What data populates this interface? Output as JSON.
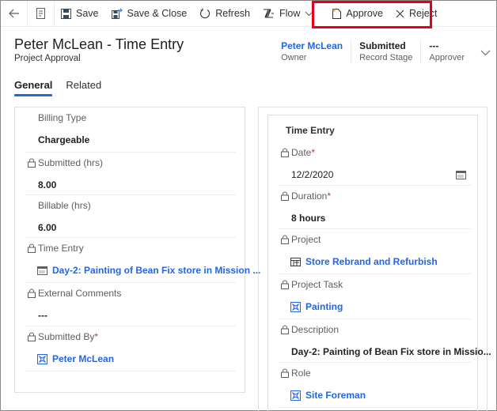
{
  "command_bar": {
    "back_icon": "back-arrow-icon",
    "form_icon": "form-icon",
    "save_label": "Save",
    "save_close_label": "Save & Close",
    "refresh_label": "Refresh",
    "flow_label": "Flow",
    "approve_label": "Approve",
    "reject_label": "Reject",
    "highlight_color": "#e3001b"
  },
  "header": {
    "title": "Peter McLean - Time Entry",
    "subtitle": "Project Approval",
    "fields": [
      {
        "value": "Peter McLean",
        "label": "Owner"
      },
      {
        "value": "Submitted",
        "label": "Record Stage"
      },
      {
        "value": "---",
        "label": "Approver"
      }
    ]
  },
  "tabs": [
    {
      "label": "General",
      "active": true
    },
    {
      "label": "Related",
      "active": false
    }
  ],
  "left_section": {
    "fields": [
      {
        "label": "Billing Type",
        "value": "Chargeable",
        "locked": false
      },
      {
        "label": "Submitted (hrs)",
        "value": "8.00",
        "locked": true
      },
      {
        "label": "Billable (hrs)",
        "value": "6.00",
        "locked": false
      },
      {
        "label": "Time Entry",
        "value": "Day-2: Painting of Bean Fix store in Mission ...",
        "locked": true
      },
      {
        "label": "External Comments",
        "value": "---",
        "locked": true
      },
      {
        "label": "Submitted By",
        "required": "*",
        "value": "Peter McLean",
        "locked": true
      }
    ]
  },
  "right_section": {
    "title": "Time Entry",
    "fields": [
      {
        "label": "Date",
        "required": "*",
        "value": "12/2/2020",
        "locked": true
      },
      {
        "label": "Duration",
        "required": "*",
        "value": "8 hours",
        "locked": true
      },
      {
        "label": "Project",
        "value": "Store Rebrand and Refurbish",
        "locked": true
      },
      {
        "label": "Project Task",
        "value": "Painting",
        "locked": true
      },
      {
        "label": "Description",
        "value": "Day-2: Painting of Bean Fix store in Missio...",
        "locked": true
      },
      {
        "label": "Role",
        "value": "Site Foreman",
        "locked": true
      }
    ]
  },
  "colors": {
    "link": "#2266e3",
    "required": "#c4314b",
    "tab_underline": "#2266e3"
  }
}
